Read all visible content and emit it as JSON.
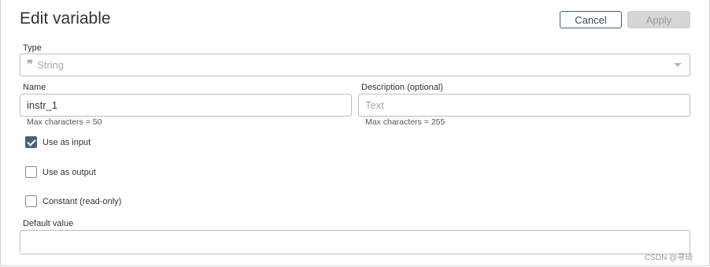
{
  "dialog": {
    "title": "Edit variable",
    "cancel_label": "Cancel",
    "apply_label": "Apply"
  },
  "type": {
    "label": "Type",
    "icon": "quote-icon",
    "value": "String"
  },
  "name": {
    "label": "Name",
    "value": "instr_1",
    "hint": "Max characters = 50"
  },
  "description": {
    "label": "Description (optional)",
    "placeholder": "Text",
    "hint": "Max characters = 255"
  },
  "options": [
    {
      "label": "Use as input",
      "checked": true
    },
    {
      "label": "Use as output",
      "checked": false
    },
    {
      "label": "Constant (read-only)",
      "checked": false
    }
  ],
  "default_value": {
    "label": "Default value",
    "value": ""
  },
  "watermark": "CSDN @寻琦",
  "colors": {
    "accent": "#4a6179",
    "cancel_border": "#41647f",
    "apply_disabled_bg": "#d6d6d6"
  }
}
